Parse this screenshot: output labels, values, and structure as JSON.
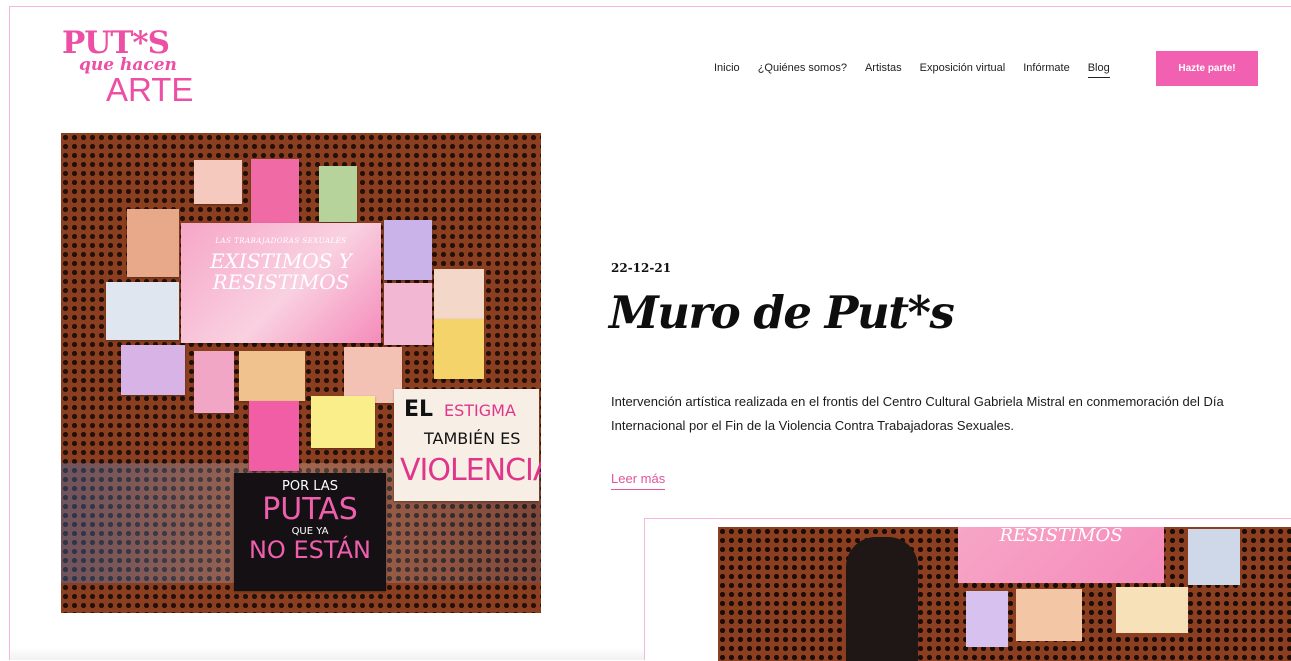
{
  "brand": {
    "line1": "PUT*S",
    "line2": "que hacen",
    "line3": "ARTE"
  },
  "nav": {
    "items": [
      "Inicio",
      "¿Quiénes somos?",
      "Artistas",
      "Exposición virtual",
      "Infórmate",
      "Blog"
    ],
    "active": "Blog",
    "cta": "Hazte parte!"
  },
  "post": {
    "date": "22-12-21",
    "title": "Muro de Put*s",
    "description": "Intervención artística realizada en el frontis del Centro Cultural Gabriela Mistral en conmemoración del Día Internacional por el Fin de la Violencia Contra Trabajadoras Sexuales.",
    "read_more": "Leer más"
  },
  "hero_image": {
    "poster_small": "LAS TRABAJADORAS SEXUALES",
    "poster_big": "EXISTIMOS Y RESISTIMOS",
    "sign1": [
      "EL",
      "ESTIGMA",
      "TAMBIÉN ES",
      "VIOLENCIA"
    ],
    "sign2": [
      "POR LAS",
      "PUTAS",
      "QUE YA",
      "NO ESTÁN"
    ]
  },
  "second_image": {
    "banner": "RESISTIMOS"
  },
  "colors": {
    "brand_pink": "#ec4fa3",
    "button_pink": "#f160b1",
    "link_pink": "#e0559c",
    "frame_pink": "#f4b8de"
  }
}
